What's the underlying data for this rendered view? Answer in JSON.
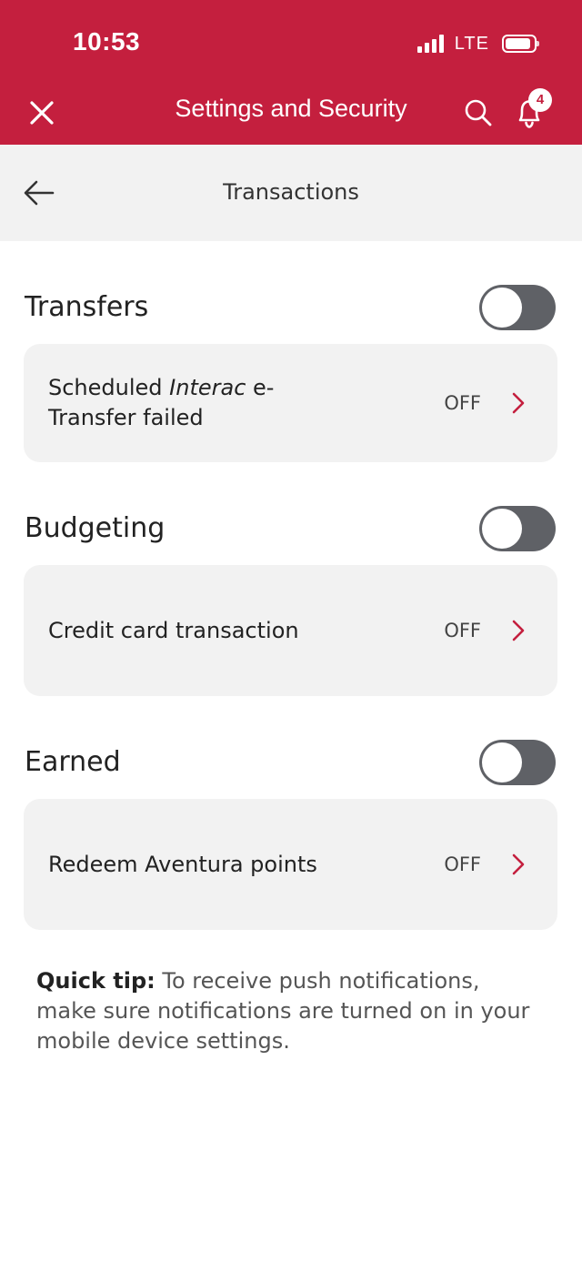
{
  "status_bar": {
    "time": "10:53",
    "network": "LTE"
  },
  "header": {
    "title": "Settings and Security",
    "notification_count": "4"
  },
  "subheader": {
    "title": "Transactions"
  },
  "sections": [
    {
      "title": "Transfers",
      "toggle_on": false,
      "item": {
        "label_prefix": "Scheduled ",
        "label_italic": "Interac",
        "label_suffix": " e-Transfer failed",
        "value": "OFF"
      }
    },
    {
      "title": "Budgeting",
      "toggle_on": false,
      "item": {
        "label": "Credit card transaction",
        "value": "OFF"
      }
    },
    {
      "title": "Earned",
      "toggle_on": false,
      "item": {
        "label": "Redeem Aventura points",
        "value": "OFF"
      }
    }
  ],
  "quick_tip": {
    "label": "Quick tip:",
    "text": " To receive push notifications, make sure notifications are turned on in your mobile device settings."
  },
  "colors": {
    "brand": "#c41f3e",
    "toggle_off": "#5f6166",
    "card_bg": "#f2f2f2"
  },
  "icons": [
    "close-icon",
    "search-icon",
    "bell-icon",
    "back-arrow-icon",
    "chevron-right-icon"
  ]
}
